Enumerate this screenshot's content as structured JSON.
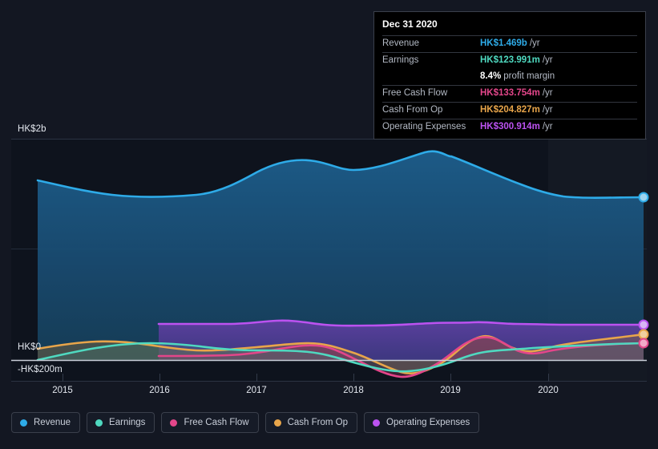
{
  "tooltip": {
    "date": "Dec 31 2020",
    "rows": [
      {
        "key": "Revenue",
        "value": "HK$1.469b",
        "unit": "/yr",
        "color": "#2eabe8"
      },
      {
        "key": "Earnings",
        "value": "HK$123.991m",
        "unit": "/yr",
        "color": "#4fd9c0"
      },
      {
        "key": "",
        "value": "8.4%",
        "unit": "profit margin",
        "color": "#ffffff"
      },
      {
        "key": "Free Cash Flow",
        "value": "HK$133.754m",
        "unit": "/yr",
        "color": "#e3468a"
      },
      {
        "key": "Cash From Op",
        "value": "HK$204.827m",
        "unit": "/yr",
        "color": "#e8a54a"
      },
      {
        "key": "Operating Expenses",
        "value": "HK$300.914m",
        "unit": "/yr",
        "color": "#bb52f0"
      }
    ]
  },
  "legend": {
    "items": [
      {
        "label": "Revenue",
        "color": "#2eabe8"
      },
      {
        "label": "Earnings",
        "color": "#4fd9c0"
      },
      {
        "label": "Free Cash Flow",
        "color": "#e3468a"
      },
      {
        "label": "Cash From Op",
        "color": "#e8a54a"
      },
      {
        "label": "Operating Expenses",
        "color": "#bb52f0"
      }
    ]
  },
  "chart_data": {
    "type": "area",
    "title": "",
    "xlabel": "",
    "ylabel": "",
    "grid": true,
    "legend_position": "bottom",
    "ylim": [
      -200,
      2000
    ],
    "yunit": "HK$ millions",
    "y_ticks": [
      {
        "label": "HK$2b",
        "value": 2000
      },
      {
        "label": "HK$1b",
        "value": 1000
      },
      {
        "label": "HK$0",
        "value": 0
      },
      {
        "label": "-HK$200m",
        "value": -200
      }
    ],
    "y_ticks_visible": [
      "HK$2b",
      "HK$0",
      "-HK$200m"
    ],
    "x_ticks": [
      "2015",
      "2016",
      "2017",
      "2018",
      "2019",
      "2020"
    ],
    "x_range": [
      "2014-09",
      "2021-03"
    ],
    "forecast_region_start": "2020",
    "series": [
      {
        "name": "Revenue",
        "color": "#2eabe8",
        "x": [
          "2014-09",
          "2015-03",
          "2015-09",
          "2016-03",
          "2016-09",
          "2017-03",
          "2017-09",
          "2018-03",
          "2018-09",
          "2019-03",
          "2019-09",
          "2020-03",
          "2020-09",
          "2020-12",
          "2021-03"
        ],
        "values": [
          1588,
          1520,
          1445,
          1440,
          1460,
          1600,
          1690,
          1655,
          1680,
          1790,
          1855,
          1720,
          1540,
          1469,
          1475
        ]
      },
      {
        "name": "Earnings",
        "color": "#4fd9c0",
        "x": [
          "2014-09",
          "2015-03",
          "2015-09",
          "2016-03",
          "2016-09",
          "2017-03",
          "2017-09",
          "2018-03",
          "2018-09",
          "2019-03",
          "2019-09",
          "2020-03",
          "2020-09",
          "2020-12",
          "2021-03"
        ],
        "values": [
          -15,
          30,
          55,
          50,
          25,
          50,
          60,
          30,
          -90,
          -110,
          -30,
          40,
          90,
          124,
          125
        ]
      },
      {
        "name": "Free Cash Flow",
        "color": "#e3468a",
        "x": [
          "2015-09",
          "2016-03",
          "2016-09",
          "2017-03",
          "2017-09",
          "2018-03",
          "2018-09",
          "2019-03",
          "2019-09",
          "2020-03",
          "2020-09",
          "2020-12",
          "2021-03"
        ],
        "values": [
          -45,
          -45,
          -40,
          20,
          40,
          -65,
          -175,
          -60,
          110,
          20,
          75,
          134,
          135
        ]
      },
      {
        "name": "Cash From Op",
        "color": "#e8a54a",
        "x": [
          "2014-09",
          "2015-03",
          "2015-09",
          "2016-03",
          "2016-09",
          "2017-03",
          "2017-09",
          "2018-03",
          "2018-09",
          "2019-03",
          "2019-09",
          "2020-03",
          "2020-09",
          "2020-12",
          "2021-03"
        ],
        "values": [
          60,
          85,
          95,
          75,
          45,
          55,
          80,
          10,
          -110,
          -40,
          180,
          80,
          160,
          205,
          205
        ]
      },
      {
        "name": "Operating Expenses",
        "color": "#bb52f0",
        "x": [
          "2015-09",
          "2016-03",
          "2016-09",
          "2017-03",
          "2017-09",
          "2018-03",
          "2018-09",
          "2019-03",
          "2019-09",
          "2020-03",
          "2020-09",
          "2020-12",
          "2021-03"
        ],
        "values": [
          330,
          330,
          330,
          345,
          330,
          305,
          300,
          310,
          335,
          300,
          310,
          301,
          300
        ]
      }
    ],
    "endpoint_markers": true
  }
}
